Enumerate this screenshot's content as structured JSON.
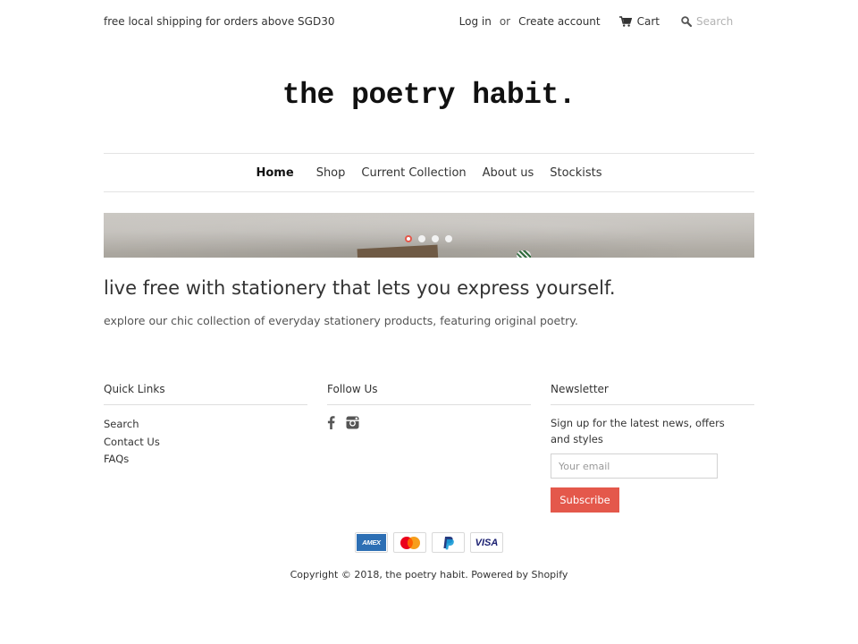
{
  "topbar": {
    "shipping_text": "free local shipping for orders above SGD30",
    "login_label": "Log in",
    "or_text": "or",
    "create_account_label": "Create account",
    "cart_label": "Cart",
    "cart_icon": "cart-icon",
    "search_icon": "search-icon",
    "search_placeholder": "Search"
  },
  "logo": {
    "text": "the poetry habit."
  },
  "nav": {
    "items": [
      {
        "label": "Home",
        "active": true
      },
      {
        "label": "Shop"
      },
      {
        "label": "Current Collection"
      },
      {
        "label": "About us"
      },
      {
        "label": "Stockists"
      }
    ]
  },
  "slideshow": {
    "slide_count": 4,
    "active_index": 0,
    "active_color": "#e4584b"
  },
  "hero": {
    "headline": "live free with stationery that lets you express yourself.",
    "subheadline": "explore our chic collection of everyday stationery products, featuring original poetry."
  },
  "footer": {
    "quick_links": {
      "title": "Quick Links",
      "items": [
        "Search",
        "Contact Us",
        "FAQs"
      ]
    },
    "follow_us": {
      "title": "Follow Us",
      "icons": [
        "facebook-icon",
        "instagram-icon"
      ]
    },
    "newsletter": {
      "title": "Newsletter",
      "description": "Sign up for the latest news, offers and styles",
      "email_placeholder": "Your email",
      "subscribe_label": "Subscribe",
      "button_color": "#e4584b"
    },
    "payments": [
      "amex-icon",
      "mastercard-icon",
      "paypal-icon",
      "visa-icon"
    ],
    "payment_labels": {
      "amex": "AMEX",
      "visa": "VISA"
    },
    "copyright": "Copyright © 2018, the poetry habit. Powered by Shopify"
  }
}
